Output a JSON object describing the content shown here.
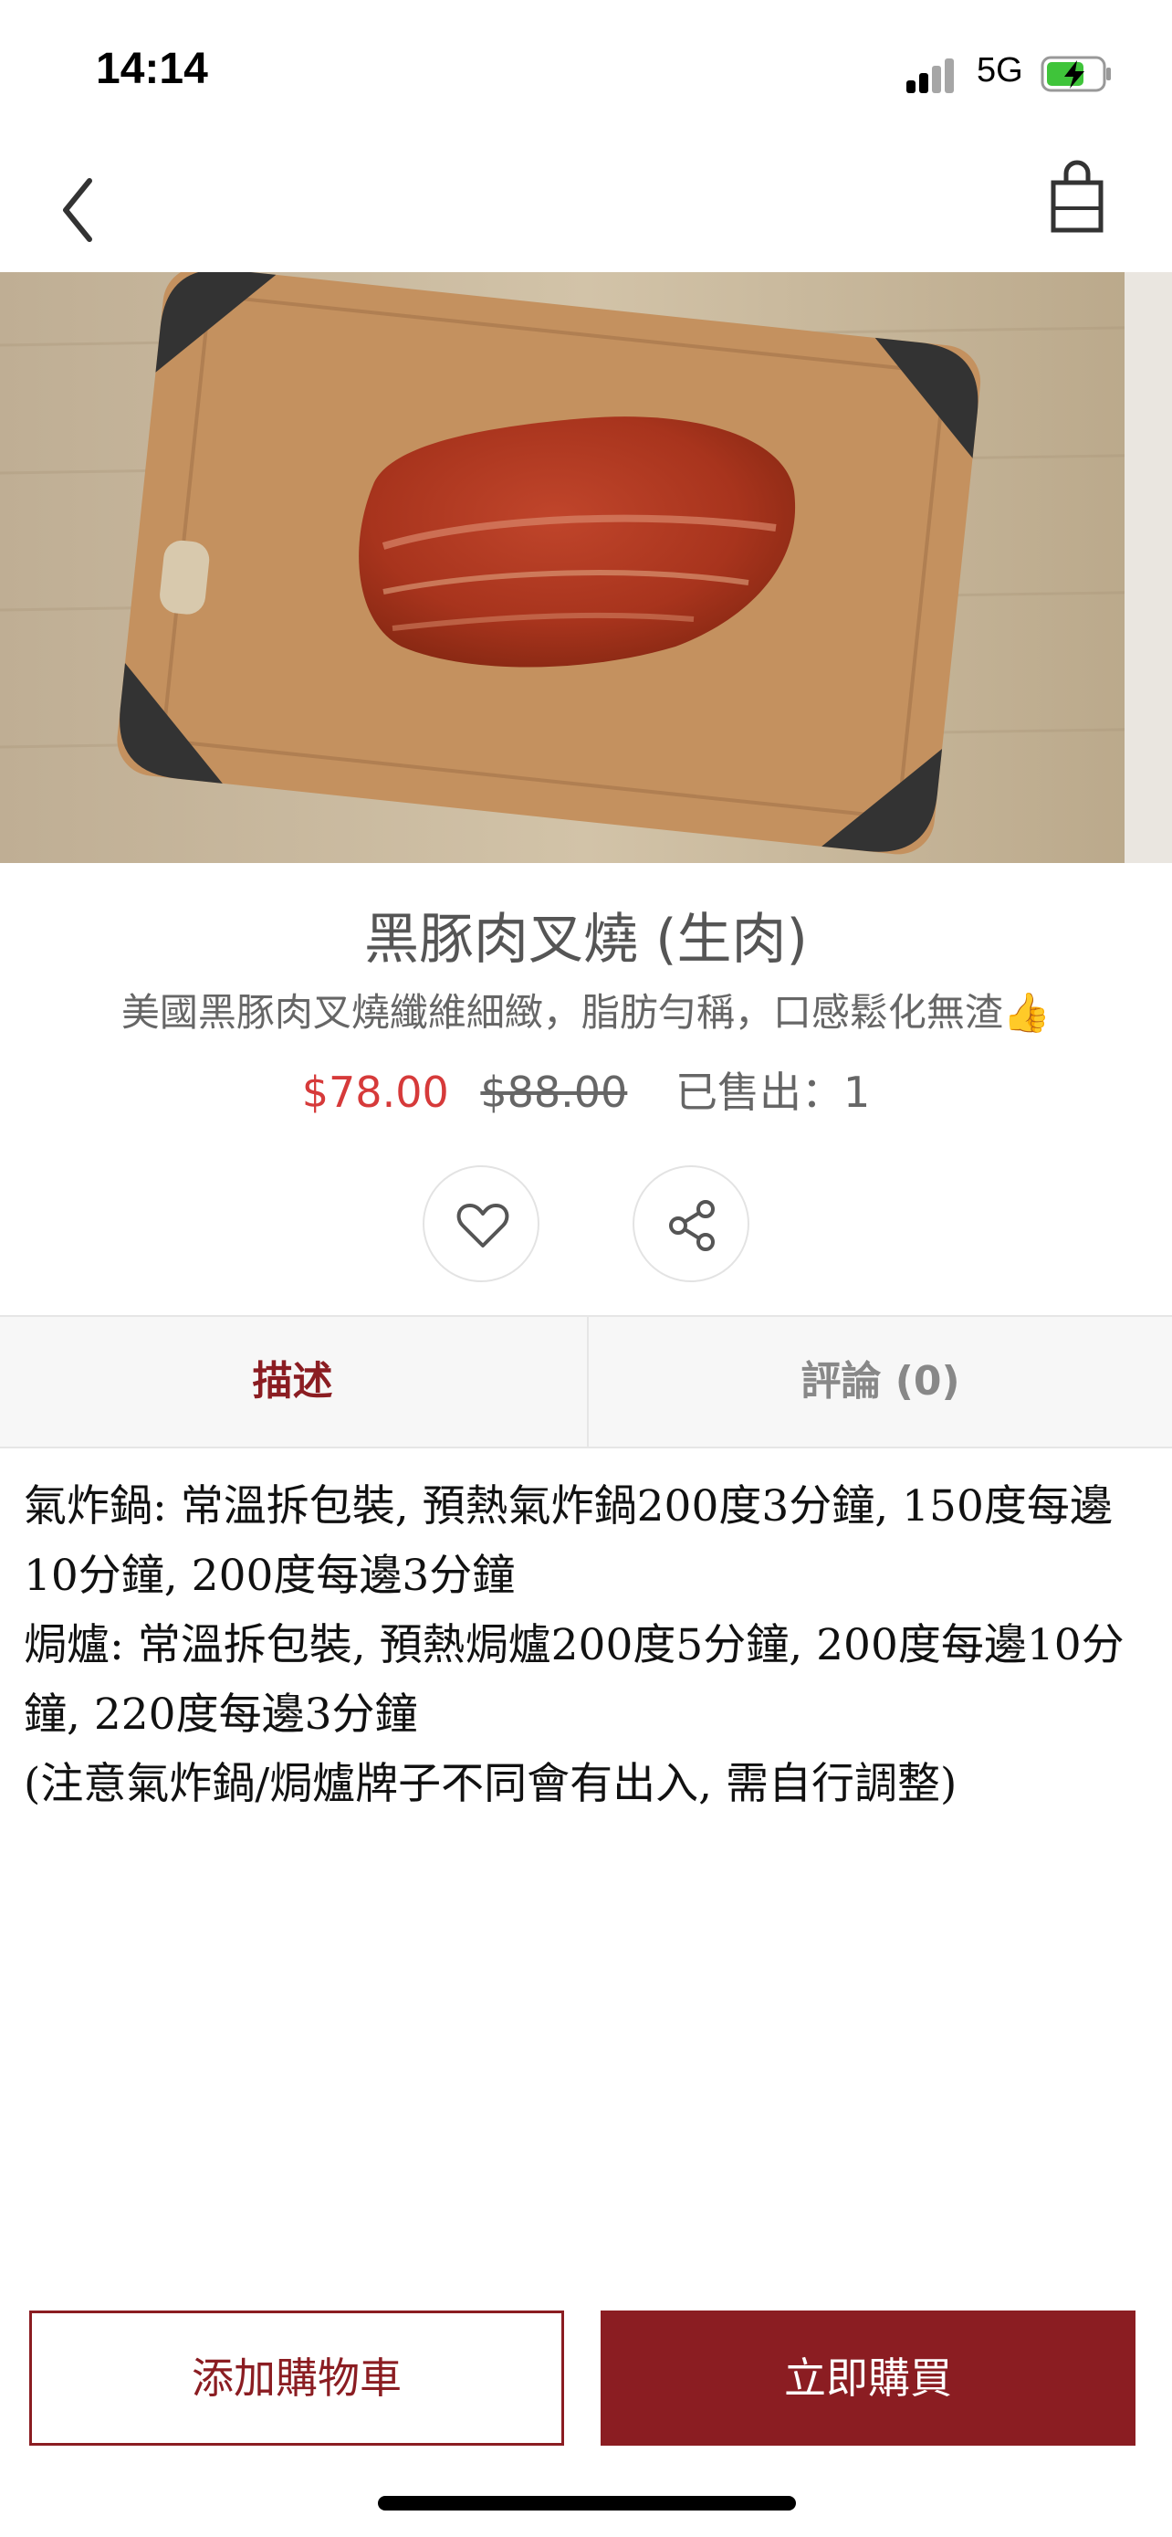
{
  "status_bar": {
    "time": "14:14",
    "network": "5G",
    "battery_icon": "battery-charging-icon"
  },
  "nav": {
    "back_icon": "chevron-left-icon",
    "bag_icon": "shopping-bag-icon"
  },
  "hero": {
    "image": "roast-pork-on-cutting-board"
  },
  "product": {
    "title": "黑豚肉叉燒 (生肉)",
    "subtitle": "美國黑豚肉叉燒纖維細緻，脂肪勻稱，口感鬆化無渣👍",
    "price": "$78.00",
    "original_price": "$88.00",
    "sold": "已售出：1"
  },
  "actions": {
    "favorite_icon": "heart-icon",
    "share_icon": "share-icon"
  },
  "tabs": [
    {
      "label": "描述",
      "active": true
    },
    {
      "label": "評論 (0)",
      "active": false
    }
  ],
  "description": {
    "lines": [
      "氣炸鍋: 常溫拆包裝, 預熱氣炸鍋200度3分鐘, 150度每邊10分鐘, 200度每邊3分鐘",
      "焗爐: 常溫拆包裝, 預熱焗爐200度5分鐘, 200度每邊10分鐘, 220度每邊3分鐘",
      "(注意氣炸鍋/焗爐牌子不同會有出入, 需自行調整)"
    ]
  },
  "buttons": {
    "add_to_cart": "添加購物車",
    "buy_now": "立即購買"
  },
  "colors": {
    "accent": "#8b1d22",
    "price": "#d63a3a"
  }
}
